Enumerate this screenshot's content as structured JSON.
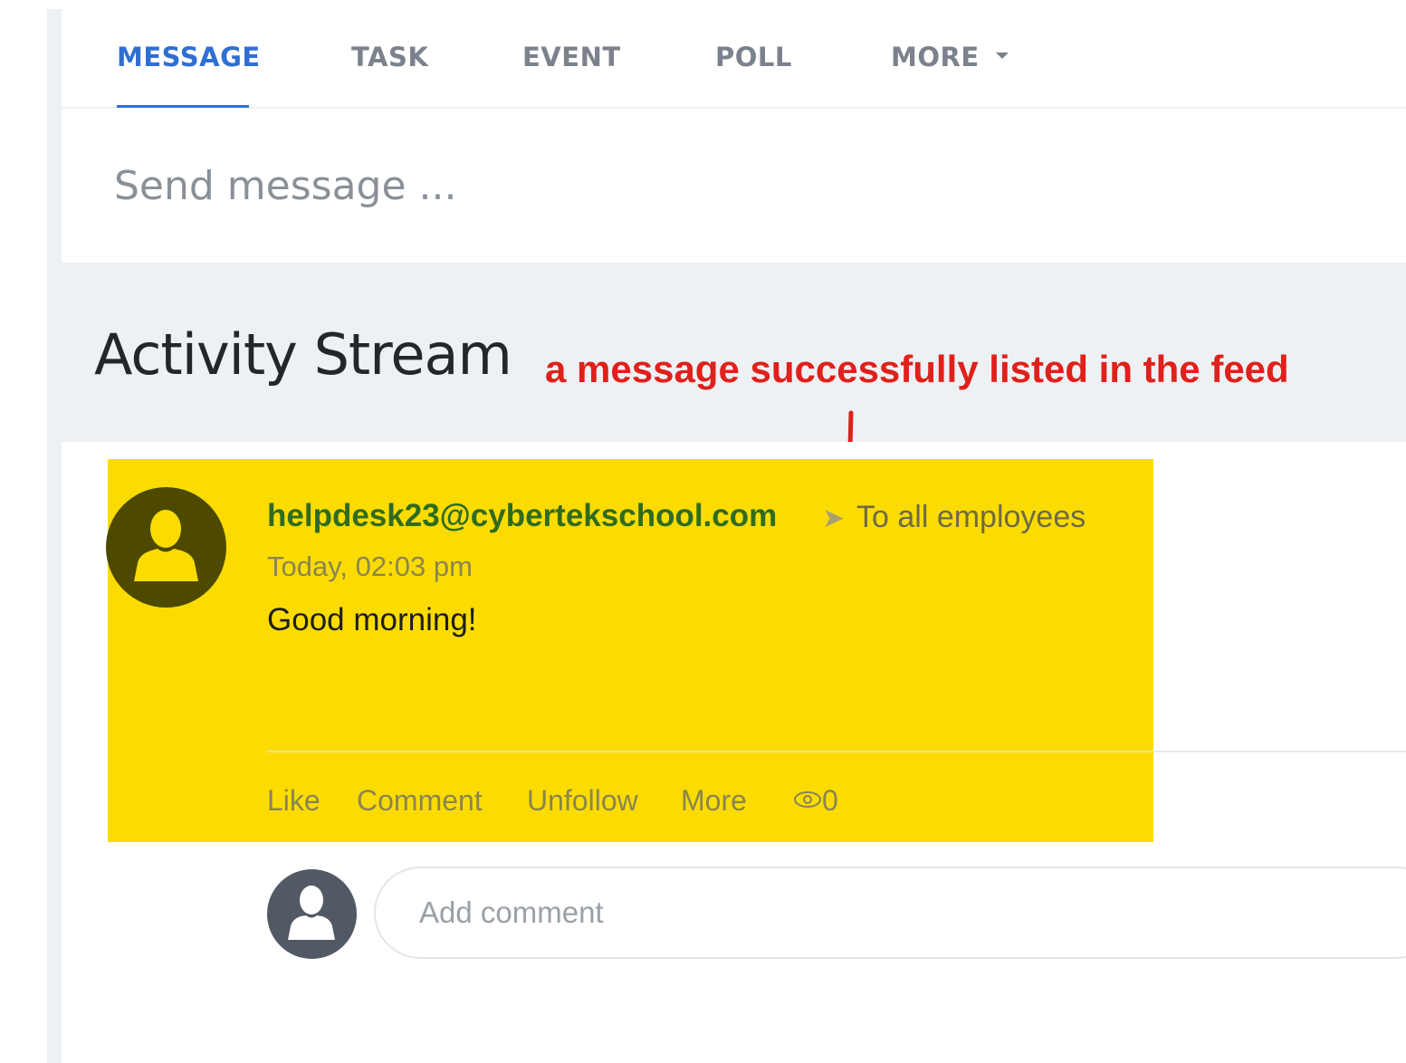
{
  "composer": {
    "tabs": [
      {
        "label": "MESSAGE"
      },
      {
        "label": "TASK"
      },
      {
        "label": "EVENT"
      },
      {
        "label": "POLL"
      },
      {
        "label": "MORE"
      }
    ],
    "active_tab": "MESSAGE",
    "placeholder": "Send message ..."
  },
  "stream": {
    "title": "Activity Stream"
  },
  "annotation": {
    "text": "a message successfully listed in the feed",
    "color": "#e0201a"
  },
  "post": {
    "author": "helpdesk23@cybertekschool.com",
    "recipient": "To all employees",
    "timestamp": "Today, 02:03 pm",
    "body": "Good morning!",
    "actions": {
      "like": "Like",
      "comment": "Comment",
      "unfollow": "Unfollow",
      "more": "More"
    },
    "views": "0",
    "highlight_color": "#fcdc00"
  },
  "comment": {
    "placeholder": "Add comment"
  },
  "colors": {
    "accent": "#2f6fd3",
    "author": "#2f6b1f"
  }
}
